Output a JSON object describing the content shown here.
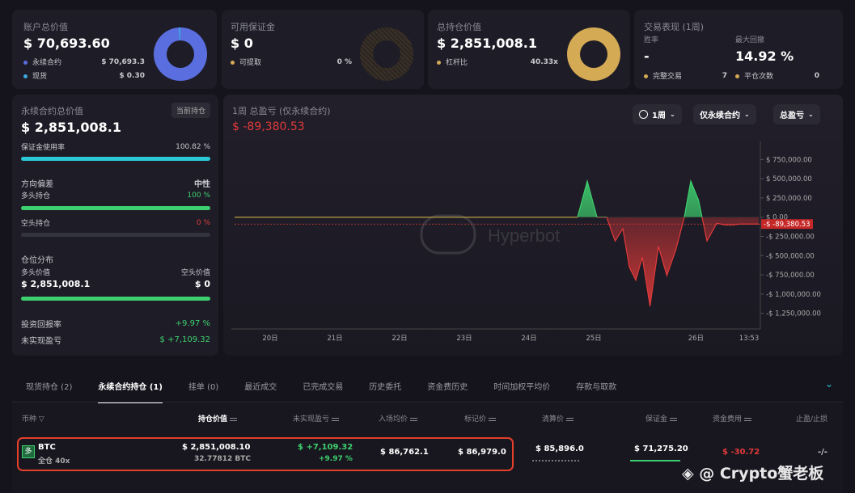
{
  "summary": {
    "account": {
      "title": "账户总价值",
      "value": "$ 70,693.60",
      "rows": [
        {
          "label": "永续合约",
          "value": "$ 70,693.3"
        },
        {
          "label": "现货",
          "value": "$ 0.30"
        }
      ]
    },
    "margin": {
      "title": "可用保证金",
      "value": "$ 0",
      "rows": [
        {
          "label": "可提取",
          "value": "0 %"
        }
      ]
    },
    "position": {
      "title": "总持仓价值",
      "value": "$ 2,851,008.1",
      "rows": [
        {
          "label": "杠杆比",
          "value": "40.33x"
        }
      ]
    },
    "performance": {
      "title": "交易表现 (1周)",
      "win_label": "胜率",
      "win_value": "-",
      "drawdown_label": "最大回撤",
      "drawdown_value": "14.92 %",
      "trades_label": "完整交易",
      "trades_value": "7",
      "flat_label": "平仓次数",
      "flat_value": "0"
    }
  },
  "left_panel": {
    "title": "永续合约总价值",
    "badge": "当前持仓",
    "value": "$ 2,851,008.1",
    "margin_use_label": "保证金使用率",
    "margin_use_value": "100.82 %",
    "margin_use_pct": 100,
    "bias_label": "方向偏差",
    "bias_value": "中性",
    "long_label": "多头持仓",
    "long_value": "100 %",
    "long_pct": 100,
    "short_label": "空头持仓",
    "short_value": "0 %",
    "short_pct": 0,
    "dist_label": "仓位分布",
    "dist_long_label": "多头价值",
    "dist_short_label": "空头价值",
    "dist_long_value": "$ 2,851,008.1",
    "dist_short_value": "$ 0",
    "dist_long_pct": 100,
    "roi_label": "投资回报率",
    "roi_value": "+9.97 %",
    "unreal_label": "未实现盈亏",
    "unreal_value": "$ +7,109.32"
  },
  "chart_panel": {
    "title": "1周 总盈亏 (仅永续合约)",
    "value": "$ -89,380.53",
    "period_button": "1周",
    "filter_button": "仅永续合约",
    "metric_button": "总盈亏",
    "watermark": "Hyperbot"
  },
  "chart_data": {
    "type": "area",
    "x_ticks": [
      "20日",
      "21日",
      "22日",
      "23日",
      "24日",
      "25日",
      "26日",
      "13:53"
    ],
    "y_ticks": [
      "$ 750,000.00",
      "$ 500,000.00",
      "$ 250,000.00",
      "$ 0.00",
      "-$ 250,000.00",
      "-$ 500,000.00",
      "-$ 750,000.00",
      "-$ 1,000,000.00",
      "-$ 1,250,000.00"
    ],
    "ylim": [
      -1380000,
      880000
    ],
    "baseline": -89380.53,
    "current_label": "-$ -89,380.53",
    "series": [
      {
        "x": [
          0,
          0.5,
          1,
          1.5,
          2,
          2.5,
          3,
          3.5,
          4,
          4.5,
          5,
          5.3,
          5.45,
          5.6,
          5.75,
          5.88,
          6.0,
          6.1,
          6.2,
          6.3,
          6.42,
          6.55,
          6.68,
          6.82,
          6.95,
          7.05,
          7.17,
          7.3,
          7.45,
          7.58,
          7.7,
          7.8,
          7.95,
          8.1
        ],
        "y": [
          0,
          0,
          0,
          0,
          0,
          0,
          0,
          0,
          0,
          0,
          0,
          0,
          470000,
          0,
          0,
          -310000,
          -150000,
          -650000,
          -820000,
          -520000,
          -1160000,
          -380000,
          -760000,
          -420000,
          0,
          470000,
          220000,
          -310000,
          -80000,
          -100000,
          -100000,
          -89380,
          -89380,
          -89380
        ]
      }
    ]
  },
  "tabs": [
    {
      "label": "现货持仓 (2)",
      "active": false
    },
    {
      "label": "永续合约持仓 (1)",
      "active": true
    },
    {
      "label": "挂单 (0)",
      "active": false
    },
    {
      "label": "最近成交",
      "active": false
    },
    {
      "label": "已完成交易",
      "active": false
    },
    {
      "label": "历史委托",
      "active": false
    },
    {
      "label": "资金费历史",
      "active": false
    },
    {
      "label": "时间加权平均价",
      "active": false
    },
    {
      "label": "存款与取款",
      "active": false
    }
  ],
  "table": {
    "headers": {
      "coin": "币种",
      "value": "持仓价值",
      "pnl": "未实现盈亏",
      "entry": "入场均价",
      "mark": "标记价",
      "liq": "清算价",
      "margin": "保证金",
      "funding": "资金费用",
      "tpsl": "止盈/止损"
    },
    "row": {
      "icon": "多",
      "coin": "BTC",
      "mode": "全仓 40x",
      "value": "$ 2,851,008.10",
      "size": "32.77812 BTC",
      "pnl": "$ +7,109.32",
      "pnl_pct": "+9.97 %",
      "entry": "$ 86,762.1",
      "mark": "$ 86,979.0",
      "liq": "$ 85,896.0",
      "margin": "$ 71,275.20",
      "funding": "$ -30.72",
      "tpsl": "-/-"
    }
  },
  "watermark_text": "@ Crypto蟹老板",
  "colors": {
    "accent_cyan": "#2bc8d6",
    "green": "#3ecf6e",
    "red": "#e23a3a",
    "blue": "#5a6ee0",
    "gold": "#d4aa55",
    "highlight": "#e5402c"
  }
}
